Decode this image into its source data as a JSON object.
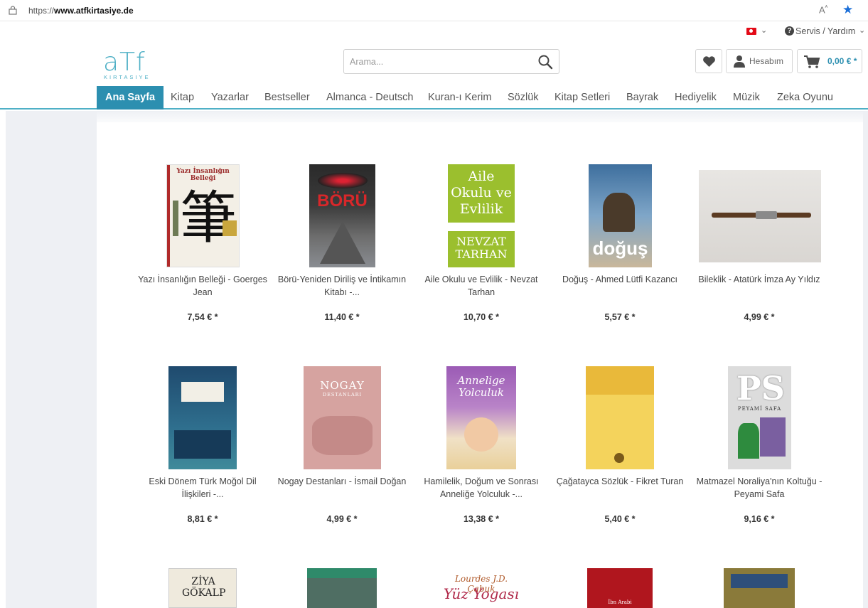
{
  "browser": {
    "url_prefix": "https://",
    "url_domain": "www.atfkirtasiye.de"
  },
  "service": {
    "flag_name": "turkey-flag",
    "help_label": "Servis / Yardım"
  },
  "header": {
    "logo_text": "aTf",
    "logo_sub": "KIRTASIYE",
    "search_placeholder": "Arama...",
    "account_label": "Hesabım",
    "cart_total": "0,00 € *"
  },
  "nav": {
    "items": [
      "Ana Sayfa",
      "Kitap",
      "Yazarlar",
      "Bestseller",
      "Almanca - Deutsch",
      "Kuran-ı Kerim",
      "Sözlük",
      "Kitap Setleri",
      "Bayrak",
      "Hediyelik",
      "Müzik",
      "Zeka Oyunu"
    ]
  },
  "products": [
    {
      "title": "Yazı İnsanlığın Belleği - Goerges Jean",
      "price": "7,54 € *",
      "cover_text": "Yazı İnsanlığın Belleği"
    },
    {
      "title": "Börü-Yeniden Diriliş ve İntikamın Kitabı -...",
      "price": "11,40 € *",
      "cover_text": "BÖRÜ"
    },
    {
      "title": "Aile Okulu ve Evlilik - Nevzat Tarhan",
      "price": "10,70 € *",
      "cover_text": "Aile Okulu ve Evlilik",
      "cover_text2": "NEVZAT TARHAN"
    },
    {
      "title": "Doğuş - Ahmed Lütfi Kazancı",
      "price": "5,57 € *",
      "cover_text": "doğuş"
    },
    {
      "title": "Bileklik - Atatürk İmza Ay Yıldız",
      "price": "4,99 € *"
    },
    {
      "title": "Eski Dönem Türk Moğol Dil İlişkileri -...",
      "price": "8,81 € *"
    },
    {
      "title": "Nogay Destanları - İsmail Doğan",
      "price": "4,99 € *",
      "cover_text": "NOGAY",
      "cover_text2": "DESTANLARI"
    },
    {
      "title": "Hamilelik, Doğum ve Sonrası Anneliğe Yolculuk -...",
      "price": "13,38 € *",
      "cover_text": "Annelige Yolculuk"
    },
    {
      "title": "Çağatayca Sözlük - Fikret Turan",
      "price": "5,40 € *"
    },
    {
      "title": "Matmazel Noraliya'nın Koltuğu - Peyami Safa",
      "price": "9,16 € *",
      "cover_text": "PEYAMİ SAFA"
    },
    {
      "title": "",
      "price": "",
      "cover_text": "ZİYA GÖKALP"
    },
    {
      "title": "",
      "price": ""
    },
    {
      "title": "",
      "price": "",
      "cover_text": "Lourdes J.D. Çabuk",
      "cover_text2": "Yüz Yogası"
    },
    {
      "title": "",
      "price": "",
      "cover_text": "İbn Arabi"
    },
    {
      "title": "",
      "price": ""
    }
  ]
}
